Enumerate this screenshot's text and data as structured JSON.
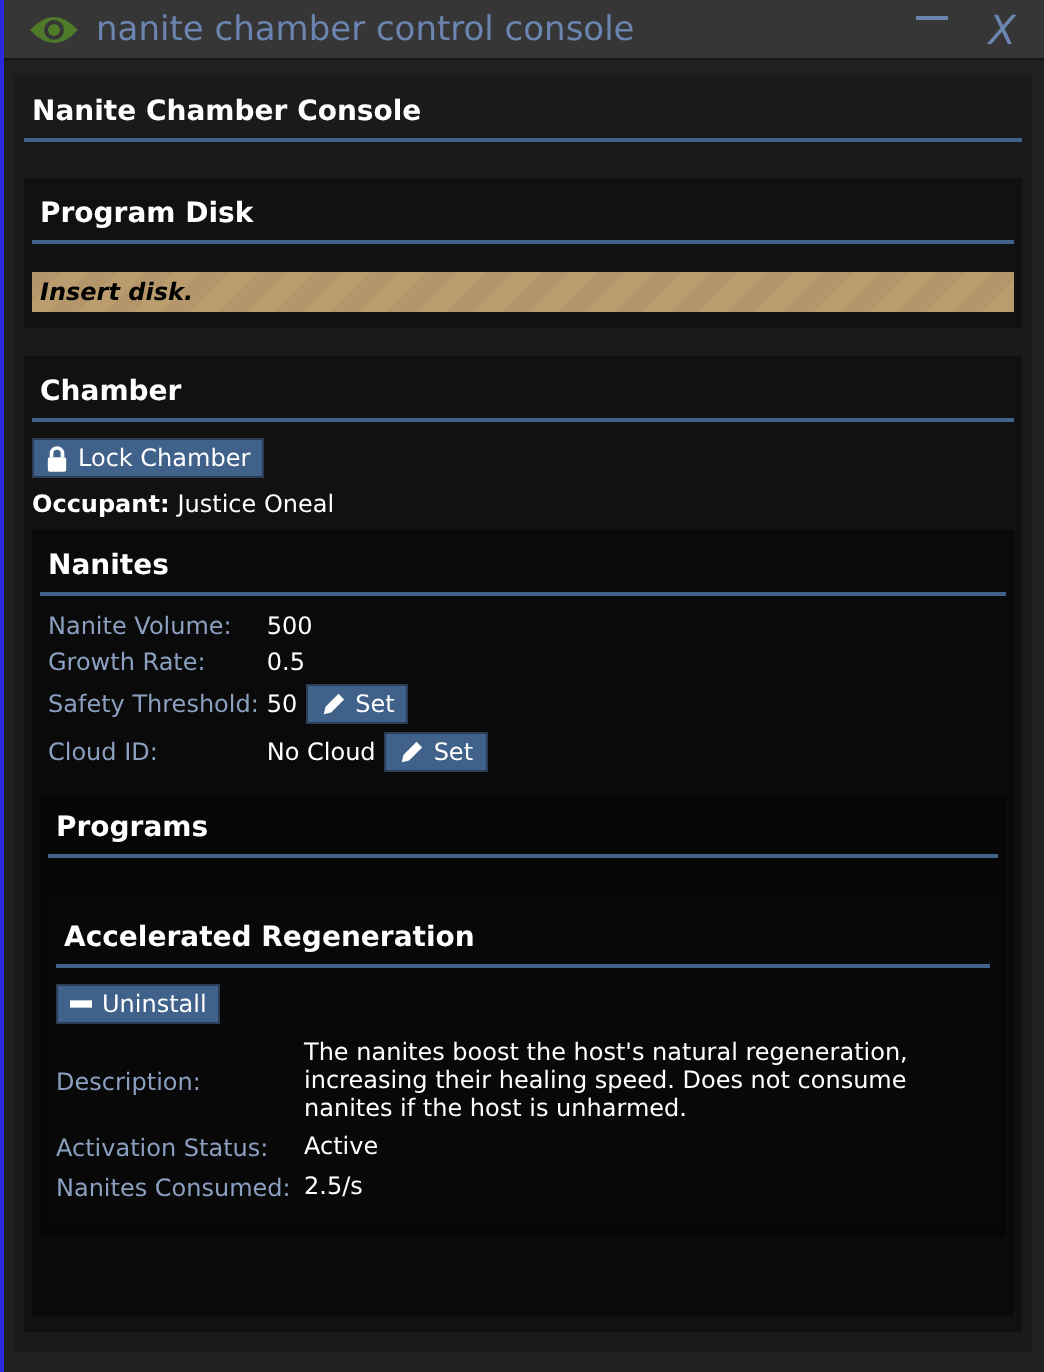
{
  "window": {
    "title": "nanite chamber control console",
    "buttons": [
      {
        "kind": "minimize"
      },
      {
        "kind": "close",
        "label": "X"
      }
    ]
  },
  "console": {
    "title": "Nanite Chamber Console"
  },
  "program_disk": {
    "title": "Program Disk",
    "notice": "Insert disk."
  },
  "chamber": {
    "title": "Chamber",
    "lock_button": "Lock Chamber",
    "occupant_label": "Occupant:",
    "occupant": "Justice Oneal"
  },
  "nanites": {
    "title": "Nanites",
    "rows": [
      {
        "kind": "plain",
        "label": "Nanite Volume:",
        "value": "500"
      },
      {
        "kind": "plain",
        "label": "Growth Rate:",
        "value": "0.5"
      },
      {
        "kind": "editable",
        "label": "Safety Threshold:",
        "value": "50",
        "button": "Set"
      },
      {
        "kind": "editable",
        "label": "Cloud ID:",
        "value": "No Cloud",
        "button": "Set"
      }
    ]
  },
  "programs": {
    "title": "Programs",
    "items": [
      {
        "name": "Accelerated Regeneration",
        "button": "Uninstall",
        "rows": [
          {
            "label": "Description:",
            "value": "The nanites boost the host's natural regeneration, increasing their healing speed. Does not consume nanites if the host is unharmed."
          },
          {
            "label": "Activation Status:",
            "value": "Active"
          },
          {
            "label": "Nanites Consumed:",
            "value": "2.5/s"
          }
        ]
      }
    ]
  }
}
